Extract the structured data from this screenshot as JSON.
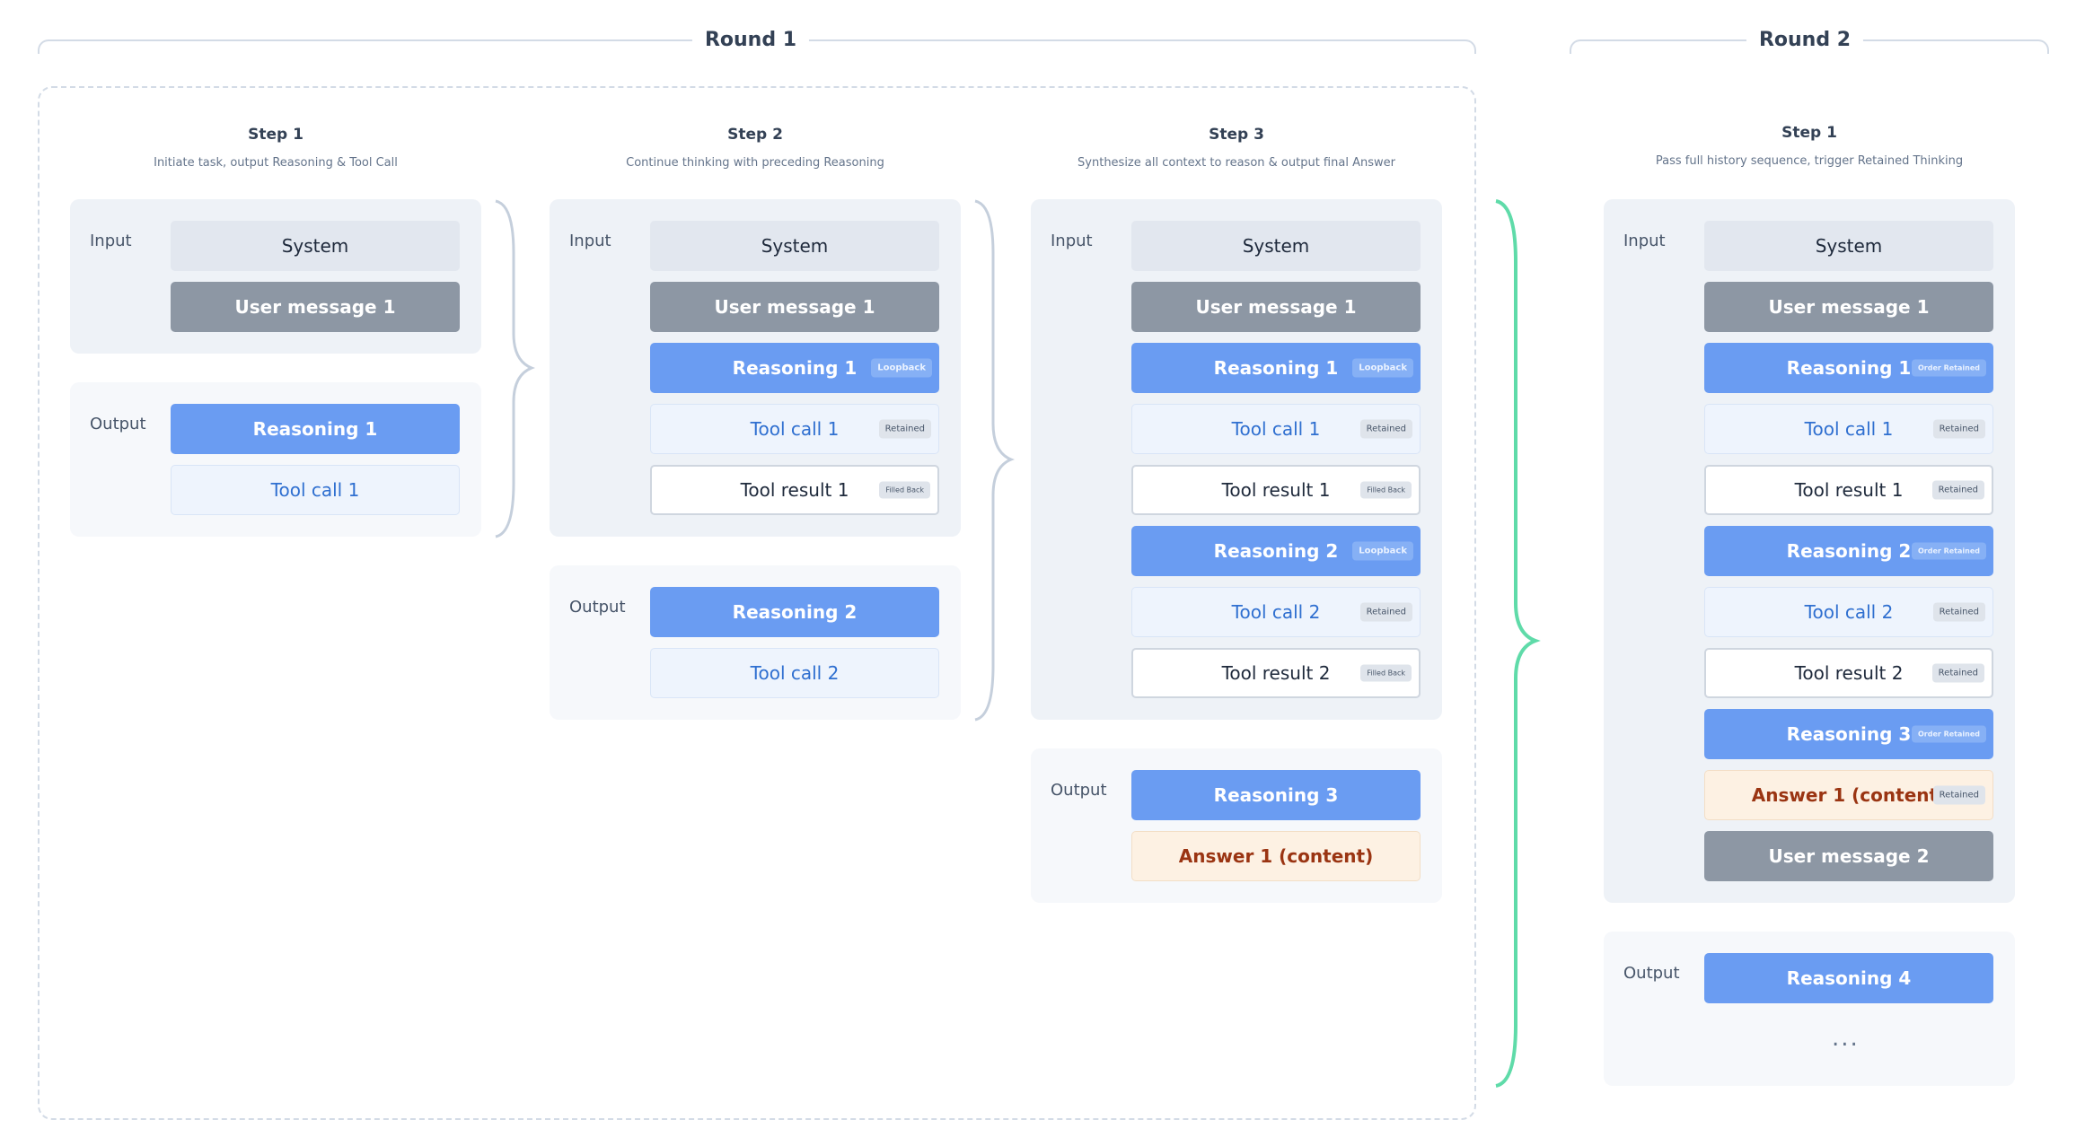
{
  "rounds": {
    "r1": "Round 1",
    "r2": "Round 2"
  },
  "labels": {
    "input": "Input",
    "output": "Output"
  },
  "blocks": {
    "system": "System",
    "user1": "User message 1",
    "user2": "User message 2",
    "reasoning1": "Reasoning 1",
    "reasoning2": "Reasoning 2",
    "reasoning3": "Reasoning 3",
    "reasoning4": "Reasoning 4",
    "toolcall1": "Tool call 1",
    "toolcall2": "Tool call 2",
    "toolresult1": "Tool result 1",
    "toolresult2": "Tool result 2",
    "answer1": "Answer 1 (content)"
  },
  "tags": {
    "loopback": "Loopback",
    "retained": "Retained",
    "filled_back": "Filled Back",
    "order_retained": "Order Retained"
  },
  "steps": {
    "r1s1": {
      "title": "Step 1",
      "subtitle": "Initiate task, output Reasoning & Tool Call"
    },
    "r1s2": {
      "title": "Step 2",
      "subtitle": "Continue thinking with preceding Reasoning"
    },
    "r1s3": {
      "title": "Step 3",
      "subtitle": "Synthesize all context to reason & output final Answer"
    },
    "r2s1": {
      "title": "Step 1",
      "subtitle": "Pass full history sequence, trigger Retained Thinking"
    }
  },
  "ellipsis": "...",
  "colors": {
    "reasoning": "#6a9cf2",
    "user": "#8d97a4",
    "system": "#e2e7ef",
    "toolcall": "#eef4fd",
    "answer": "#fdf1e3",
    "connector": "#c5cfdc",
    "round_connector": "#5fdba9"
  }
}
